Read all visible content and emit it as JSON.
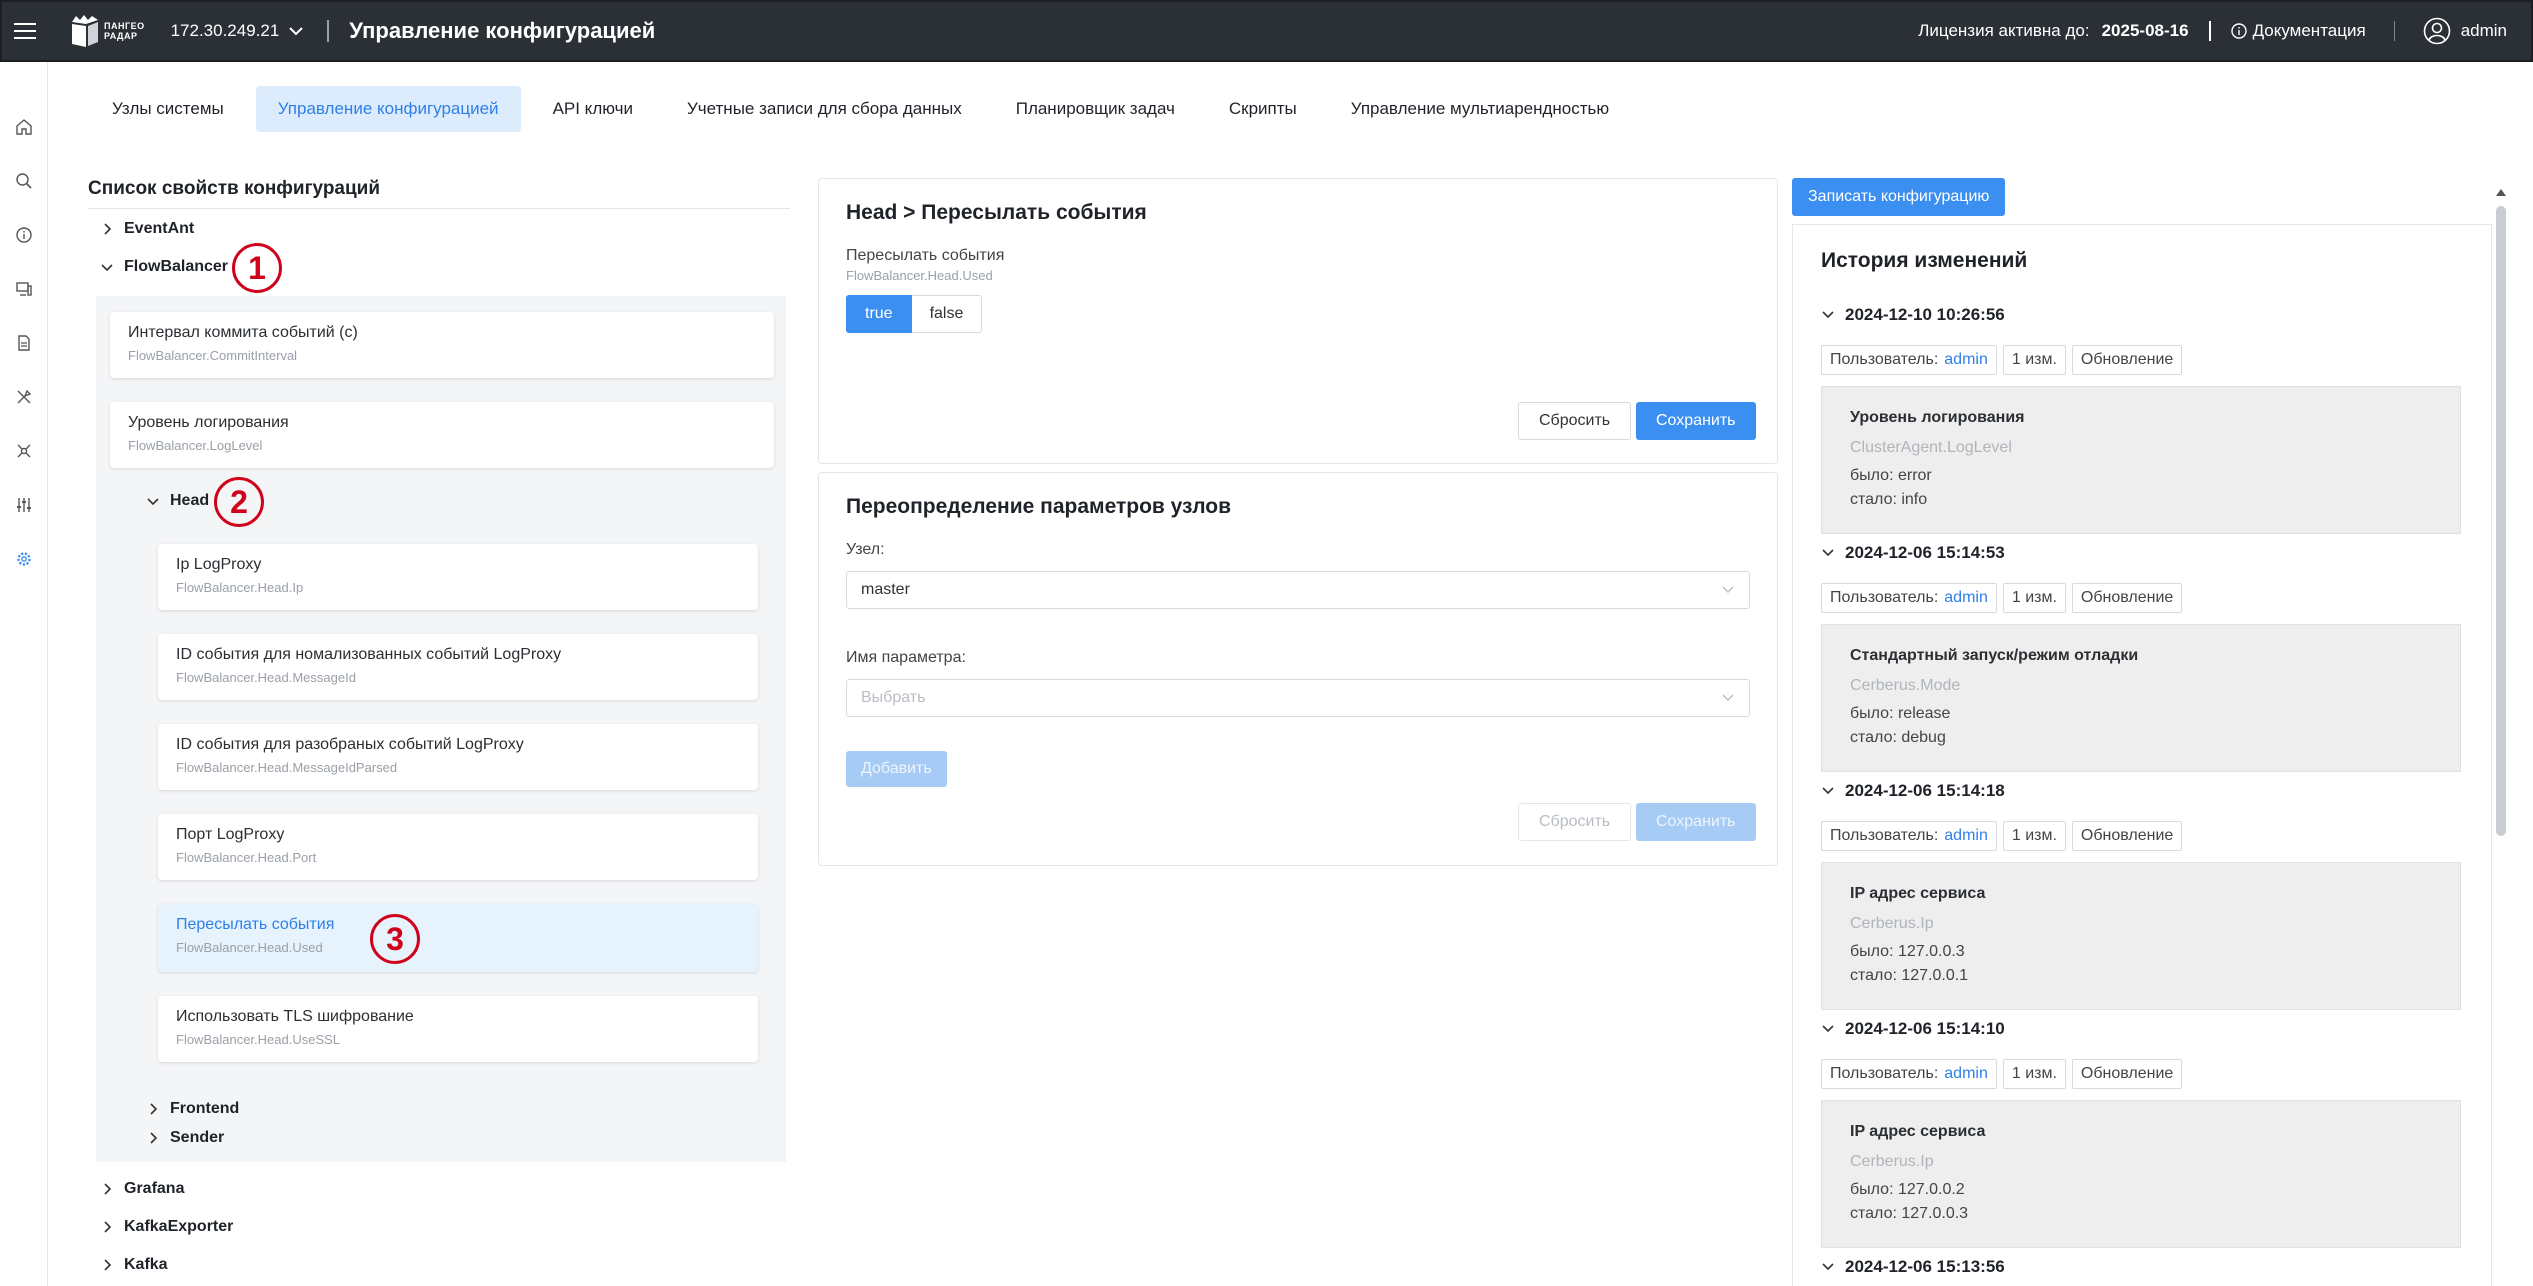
{
  "header": {
    "logo_line1": "ПАНГЕО",
    "logo_line2": "РАДАР",
    "host": "172.30.249.21",
    "title": "Управление конфигурацией",
    "license_label": "Лицензия активна до:",
    "license_date": "2025-08-16",
    "docs_label": "Документация",
    "user": "admin"
  },
  "rail": [
    "home-icon",
    "search-icon",
    "info-icon",
    "monitor-icon",
    "document-icon",
    "tools-icon",
    "network-icon",
    "sliders-icon",
    "gear-icon"
  ],
  "tabs": [
    {
      "label": "Узлы системы",
      "active": false
    },
    {
      "label": "Управление конфигурацией",
      "active": true
    },
    {
      "label": "API ключи",
      "active": false
    },
    {
      "label": "Учетные записи для сбора данных",
      "active": false
    },
    {
      "label": "Планировщик задач",
      "active": false
    },
    {
      "label": "Скрипты",
      "active": false
    },
    {
      "label": "Управление мультиарендностью",
      "active": false
    }
  ],
  "tree": {
    "title": "Список свойств конфигураций",
    "top_nodes": [
      "EventAnt",
      "FlowBalancer",
      "Grafana",
      "KafkaExporter",
      "Kafka"
    ],
    "flow_cards": [
      {
        "title": "Интервал коммита событий (с)",
        "key": "FlowBalancer.CommitInterval"
      },
      {
        "title": "Уровень логирования",
        "key": "FlowBalancer.LogLevel"
      }
    ],
    "head_node": "Head",
    "head_cards": [
      {
        "title": "Ip LogProxy",
        "key": "FlowBalancer.Head.Ip"
      },
      {
        "title": "ID события для номализованных событий LogProxy",
        "key": "FlowBalancer.Head.MessageId"
      },
      {
        "title": "ID события для разобраных событий LogProxy",
        "key": "FlowBalancer.Head.MessageIdParsed"
      },
      {
        "title": "Порт LogProxy",
        "key": "FlowBalancer.Head.Port"
      },
      {
        "title": "Пересылать события",
        "key": "FlowBalancer.Head.Used"
      },
      {
        "title": "Использовать TLS шифрование",
        "key": "FlowBalancer.Head.UseSSL"
      }
    ],
    "sub_nodes": [
      "Frontend",
      "Sender"
    ],
    "markers": [
      "1",
      "2",
      "3"
    ]
  },
  "editor": {
    "title": "Head > Пересылать события",
    "field_label": "Пересылать события",
    "field_key": "FlowBalancer.Head.Used",
    "opt_true": "true",
    "opt_false": "false",
    "reset": "Сбросить",
    "save": "Сохранить"
  },
  "override": {
    "title": "Переопределение параметров узлов",
    "node_label": "Узел:",
    "node_value": "master",
    "param_label": "Имя параметра:",
    "param_placeholder": "Выбрать",
    "add": "Добавить",
    "reset": "Сбросить",
    "save": "Сохранить"
  },
  "write_button": "Записать конфигурацию",
  "history": {
    "title": "История изменений",
    "user_label": "Пользователь:",
    "entries": [
      {
        "date": "2024-12-10 10:26:56",
        "user": "admin",
        "count": "1 изм.",
        "type": "Обновление",
        "name": "Уровень логирования",
        "key": "ClusterAgent.LogLevel",
        "was": "было: error",
        "now": "стало: info"
      },
      {
        "date": "2024-12-06 15:14:53",
        "user": "admin",
        "count": "1 изм.",
        "type": "Обновление",
        "name": "Стандартный запуск/режим отладки",
        "key": "Cerberus.Mode",
        "was": "было: release",
        "now": "стало: debug"
      },
      {
        "date": "2024-12-06 15:14:18",
        "user": "admin",
        "count": "1 изм.",
        "type": "Обновление",
        "name": "IP адрес сервиса",
        "key": "Cerberus.Ip",
        "was": "было: 127.0.0.3",
        "now": "стало: 127.0.0.1"
      },
      {
        "date": "2024-12-06 15:14:10",
        "user": "admin",
        "count": "1 изм.",
        "type": "Обновление",
        "name": "IP адрес сервиса",
        "key": "Cerberus.Ip",
        "was": "было: 127.0.0.2",
        "now": "стало: 127.0.0.3"
      },
      {
        "date": "2024-12-06 15:13:56"
      }
    ]
  },
  "colors": {
    "accent": "#3b8ff0",
    "topbar": "#2b3036",
    "marker": "#d0021b"
  }
}
